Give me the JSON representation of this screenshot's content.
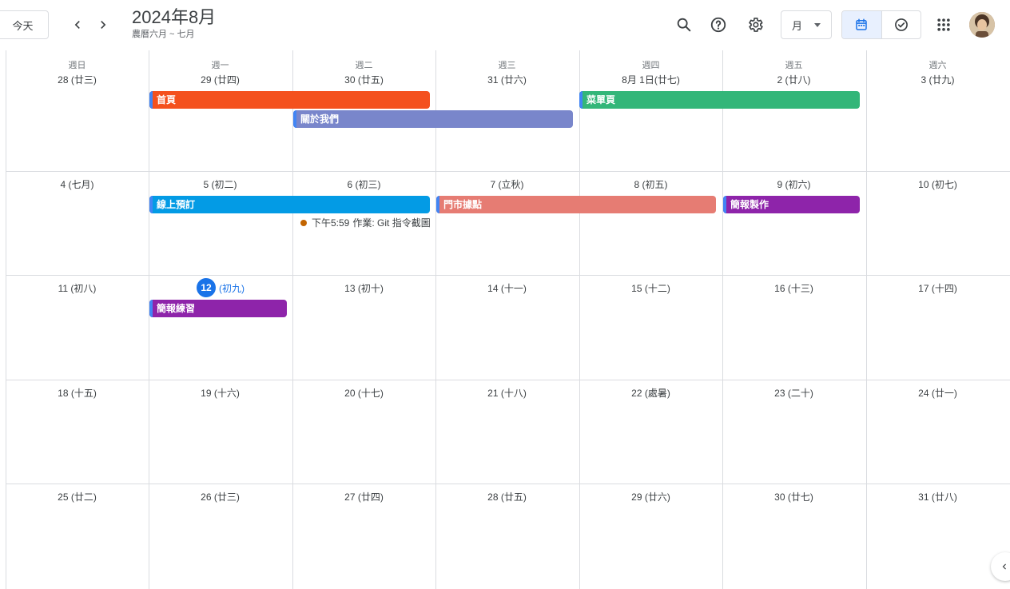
{
  "header": {
    "today_label": "今天",
    "title": "2024年8月",
    "subtitle": "農曆六月 ~ 七月",
    "view_label": "月",
    "icons": [
      "chevron-left-icon",
      "chevron-right-icon",
      "search-icon",
      "help-icon",
      "gear-icon",
      "calendar-icon",
      "task-check-icon",
      "apps-grid-icon"
    ]
  },
  "weekdays": [
    "週日",
    "週一",
    "週二",
    "週三",
    "週四",
    "週五",
    "週六"
  ],
  "weeks": [
    [
      "28 (廿三)",
      "29 (廿四)",
      "30 (廿五)",
      "31 (廿六)",
      "8月 1日(廿七)",
      "2 (廿八)",
      "3 (廿九)"
    ],
    [
      "4 (七月)",
      "5 (初二)",
      "6 (初三)",
      "7 (立秋)",
      "8 (初五)",
      "9 (初六)",
      "10 (初七)"
    ],
    [
      "11 (初八)",
      "",
      "13 (初十)",
      "14 (十一)",
      "15 (十二)",
      "16 (十三)",
      "17 (十四)"
    ],
    [
      "18 (十五)",
      "19 (十六)",
      "20 (十七)",
      "21 (十八)",
      "22 (處暑)",
      "23 (二十)",
      "24 (廿一)"
    ],
    [
      "25 (廿二)",
      "26 (廿三)",
      "27 (廿四)",
      "28 (廿五)",
      "29 (廿六)",
      "30 (廿七)",
      "31 (廿八)"
    ]
  ],
  "today": {
    "day": "12",
    "lunar": "(初九)"
  },
  "events": {
    "e1": {
      "title": "首頁",
      "color": "#f4511e"
    },
    "e2": {
      "title": "關於我們",
      "color": "#7986cb"
    },
    "e3": {
      "title": "菜單頁",
      "color": "#33b679"
    },
    "e4": {
      "title": "線上預訂",
      "color": "#039be5"
    },
    "e5": {
      "title": "門市據點",
      "color": "#e67c73"
    },
    "e6": {
      "title": "簡報製作",
      "color": "#8e24aa"
    },
    "e7": {
      "title": "簡報練習",
      "color": "#8e24aa"
    }
  },
  "timed_event": {
    "time": "下午5:59",
    "title": "作業: Git 指令截圖",
    "dot_color": "#c26401"
  },
  "colors": {
    "accent": "#1a73e8",
    "border": "#dadce0",
    "active_bg": "#e8f0fe"
  }
}
